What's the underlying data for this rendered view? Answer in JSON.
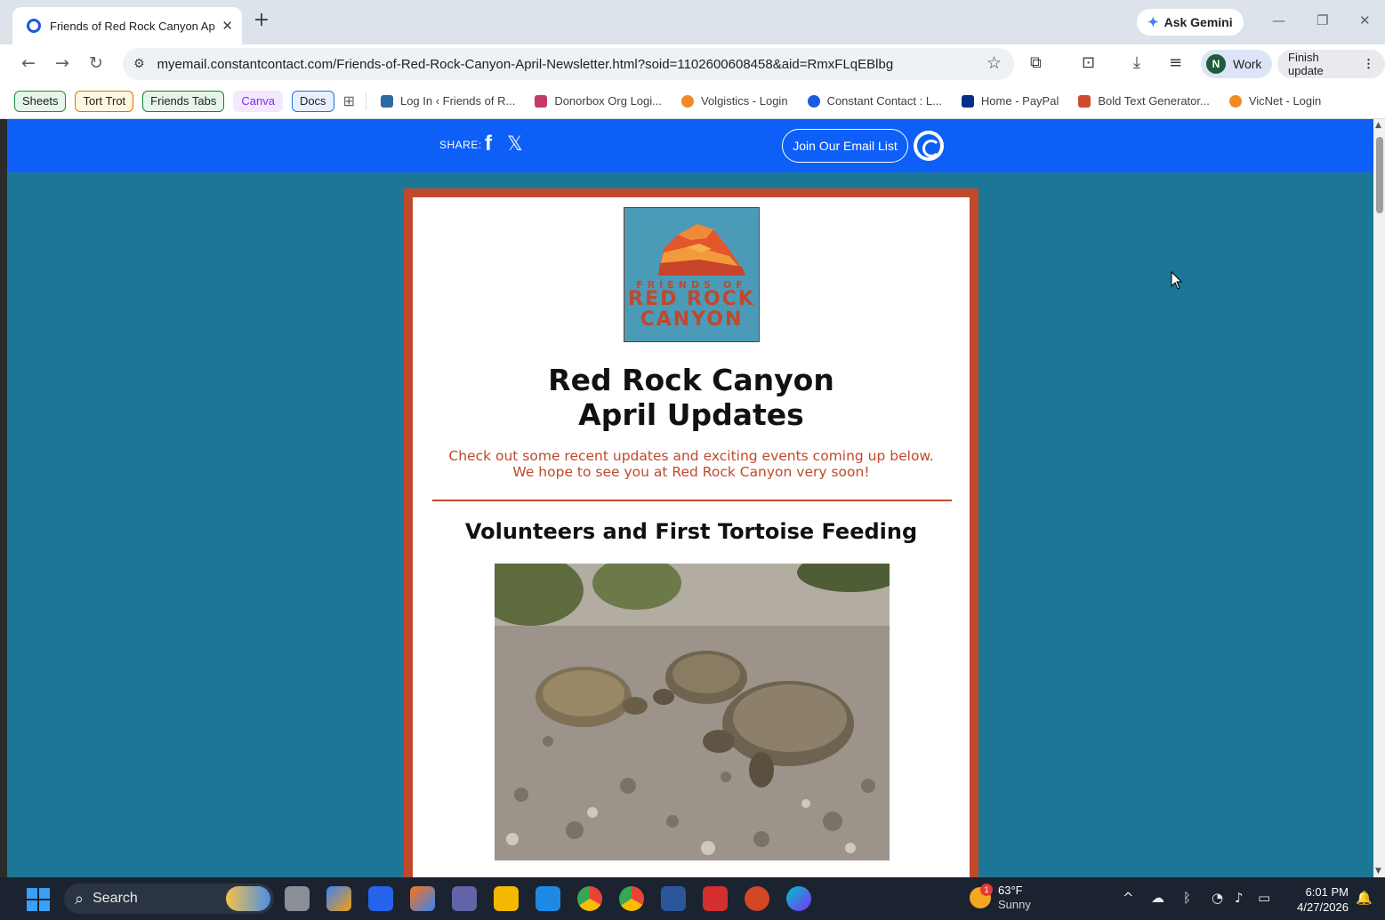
{
  "browser": {
    "tab_title": "Friends of Red Rock Canyon Ap",
    "tab_close": "✕",
    "new_tab": "+",
    "ask_gemini": "Ask Gemini",
    "url": "myemail.constantcontact.com/Friends-of-Red-Rock-Canyon-April-Newsletter.html?soid=1102600608458&aid=RmxFLqEBlbg",
    "profile_initial": "N",
    "profile_label": "Work",
    "finish_update": "Finish update"
  },
  "bookmarks": {
    "chips": [
      {
        "label": "Sheets"
      },
      {
        "label": "Tort Trot"
      },
      {
        "label": "Friends Tabs"
      },
      {
        "label": "Canva"
      },
      {
        "label": "Docs"
      }
    ],
    "links": [
      {
        "label": "Log In ‹ Friends of R...",
        "color": "#2c6aa0"
      },
      {
        "label": "Donorbox Org Logi...",
        "color": "#c7386b"
      },
      {
        "label": "Volgistics - Login",
        "color": "#f08a24"
      },
      {
        "label": "Constant Contact : L...",
        "color": "#1a5be0"
      },
      {
        "label": "Home - PayPal",
        "color": "#003087"
      },
      {
        "label": "Bold Text Generator...",
        "color": "#d24b2e"
      },
      {
        "label": "VicNet - Login",
        "color": "#f08a24"
      }
    ]
  },
  "sharebar": {
    "share_label": "SHARE:",
    "facebook_glyph": "f",
    "x_glyph": "𝕏",
    "join_label": "Join Our Email List"
  },
  "newsletter": {
    "logo_line1": "FRIENDS OF",
    "logo_line2": "RED ROCK",
    "logo_line3": "CANYON",
    "headline_line1": "Red Rock Canyon",
    "headline_line2": "April Updates",
    "intro": "Check out some recent updates and exciting events coming up below. We hope to see you at Red Rock Canyon very soon!",
    "section_title": "Volunteers and First Tortoise Feeding"
  },
  "taskbar": {
    "search_label": "Search",
    "weather_temp": "63°F",
    "weather_cond": "Sunny",
    "weather_badge": "1",
    "time": "6:01 PM",
    "date": "4/27/2026"
  },
  "colors": {
    "accent_blue": "#0d5ff7",
    "page_bg": "#1c7796",
    "newsletter_border": "#c0492b"
  }
}
